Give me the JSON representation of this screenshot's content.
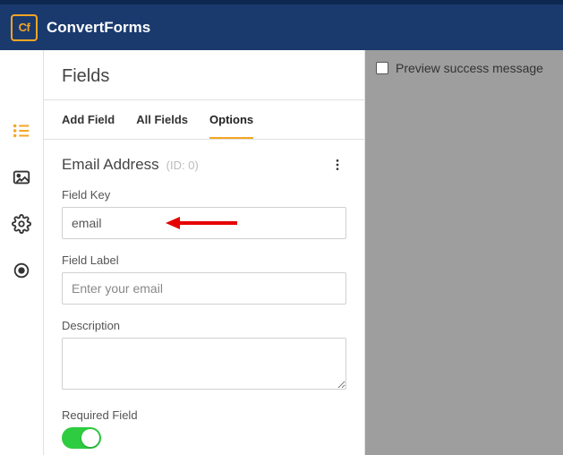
{
  "app": {
    "logo_badge": "Cf",
    "logo_text": "ConvertForms"
  },
  "sidenav": {
    "items": [
      {
        "name": "fields-icon",
        "active": true
      },
      {
        "name": "design-icon",
        "active": false
      },
      {
        "name": "settings-icon",
        "active": false
      },
      {
        "name": "submission-icon",
        "active": false
      }
    ]
  },
  "panel": {
    "title": "Fields",
    "tabs": [
      {
        "label": "Add Field",
        "active": false
      },
      {
        "label": "All Fields",
        "active": false
      },
      {
        "label": "Options",
        "active": true
      }
    ]
  },
  "field": {
    "name": "Email Address",
    "id_label": "(ID: 0)",
    "key_label": "Field Key",
    "key_value": "email",
    "label_label": "Field Label",
    "label_placeholder": "Enter your email",
    "description_label": "Description",
    "description_value": "",
    "required_label": "Required Field",
    "required_on": true
  },
  "canvas": {
    "preview_label": "Preview success message"
  }
}
